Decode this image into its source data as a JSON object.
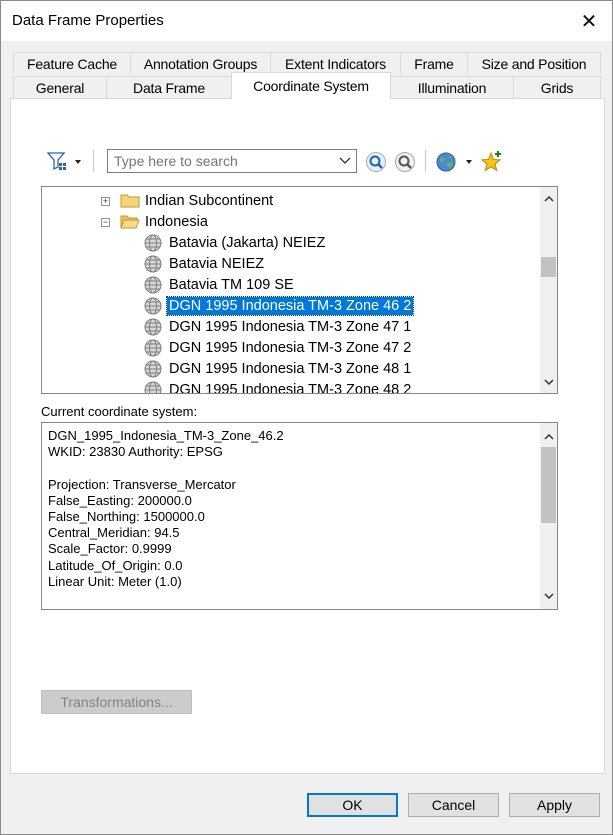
{
  "window": {
    "title": "Data Frame Properties",
    "close_glyph": "✕"
  },
  "tabs_top": [
    "Feature Cache",
    "Annotation Groups",
    "Extent Indicators",
    "Frame",
    "Size and Position"
  ],
  "tabs_bottom": [
    "General",
    "Data Frame",
    "Coordinate System",
    "Illumination",
    "Grids"
  ],
  "active_tab": "Coordinate System",
  "toolbar": {
    "filter_icon": "filter-icon",
    "search_placeholder": "Type here to search",
    "search_icon": "search-icon",
    "search_clear_icon": "search-options-icon",
    "globe_icon": "globe-icon",
    "favorite_icon": "add-favorite-icon"
  },
  "tree": {
    "items": [
      {
        "label": "Indian Subcontinent",
        "type": "folder",
        "expander": "+"
      },
      {
        "label": "Indonesia",
        "type": "folder-open",
        "expander": "−"
      },
      {
        "label": "Batavia (Jakarta) NEIEZ",
        "type": "crs"
      },
      {
        "label": "Batavia NEIEZ",
        "type": "crs"
      },
      {
        "label": "Batavia TM 109 SE",
        "type": "crs"
      },
      {
        "label": "DGN 1995 Indonesia TM-3 Zone 46 2",
        "type": "crs",
        "selected": true
      },
      {
        "label": "DGN 1995 Indonesia TM-3 Zone 47 1",
        "type": "crs"
      },
      {
        "label": "DGN 1995 Indonesia TM-3 Zone 47 2",
        "type": "crs"
      },
      {
        "label": "DGN 1995 Indonesia TM-3 Zone 48 1",
        "type": "crs"
      },
      {
        "label": "DGN 1995 Indonesia TM-3 Zone 48 2",
        "type": "crs"
      }
    ]
  },
  "current": {
    "label": "Current coordinate system:",
    "lines": [
      "DGN_1995_Indonesia_TM-3_Zone_46.2",
      "WKID: 23830 Authority: EPSG",
      "",
      "Projection: Transverse_Mercator",
      "False_Easting: 200000.0",
      "False_Northing: 1500000.0",
      "Central_Meridian: 94.5",
      "Scale_Factor: 0.9999",
      "Latitude_Of_Origin: 0.0",
      "Linear Unit: Meter (1.0)"
    ]
  },
  "buttons": {
    "transformations": "Transformations...",
    "ok": "OK",
    "cancel": "Cancel",
    "apply": "Apply"
  },
  "colors": {
    "selection": "#0078d7",
    "accent": "#0078d7"
  }
}
